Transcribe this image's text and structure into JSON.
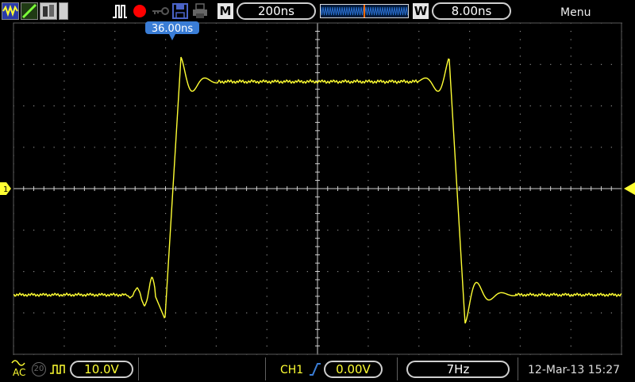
{
  "toolbar": {
    "icons": [
      "waveform-icon",
      "line-draw-icon",
      "persistence-icon",
      "trigger-run-icon",
      "stop-record-icon",
      "key-icon",
      "save-disk-icon",
      "printer-icon"
    ],
    "mode_label": "M",
    "timebase": "200ns",
    "window_label": "W",
    "window_time": "8.00ns",
    "menu_label": "Menu",
    "record_color": "#ff0000"
  },
  "marker": {
    "label": "36.00ns"
  },
  "screen": {
    "channel1_label": "1",
    "trace_color": "#ffff33",
    "marker_color": "#3a7dd6"
  },
  "status": {
    "coupling": "AC",
    "bw_limit": "20",
    "probe_icon": "square-wave-icon",
    "volts_div": "10.0V",
    "trigger_source": "CH1",
    "trigger_slope_icon": "rising-edge-icon",
    "trigger_level": "0.00V",
    "frequency": "7Hz",
    "datetime": "12-Mar-13 15:27"
  }
}
